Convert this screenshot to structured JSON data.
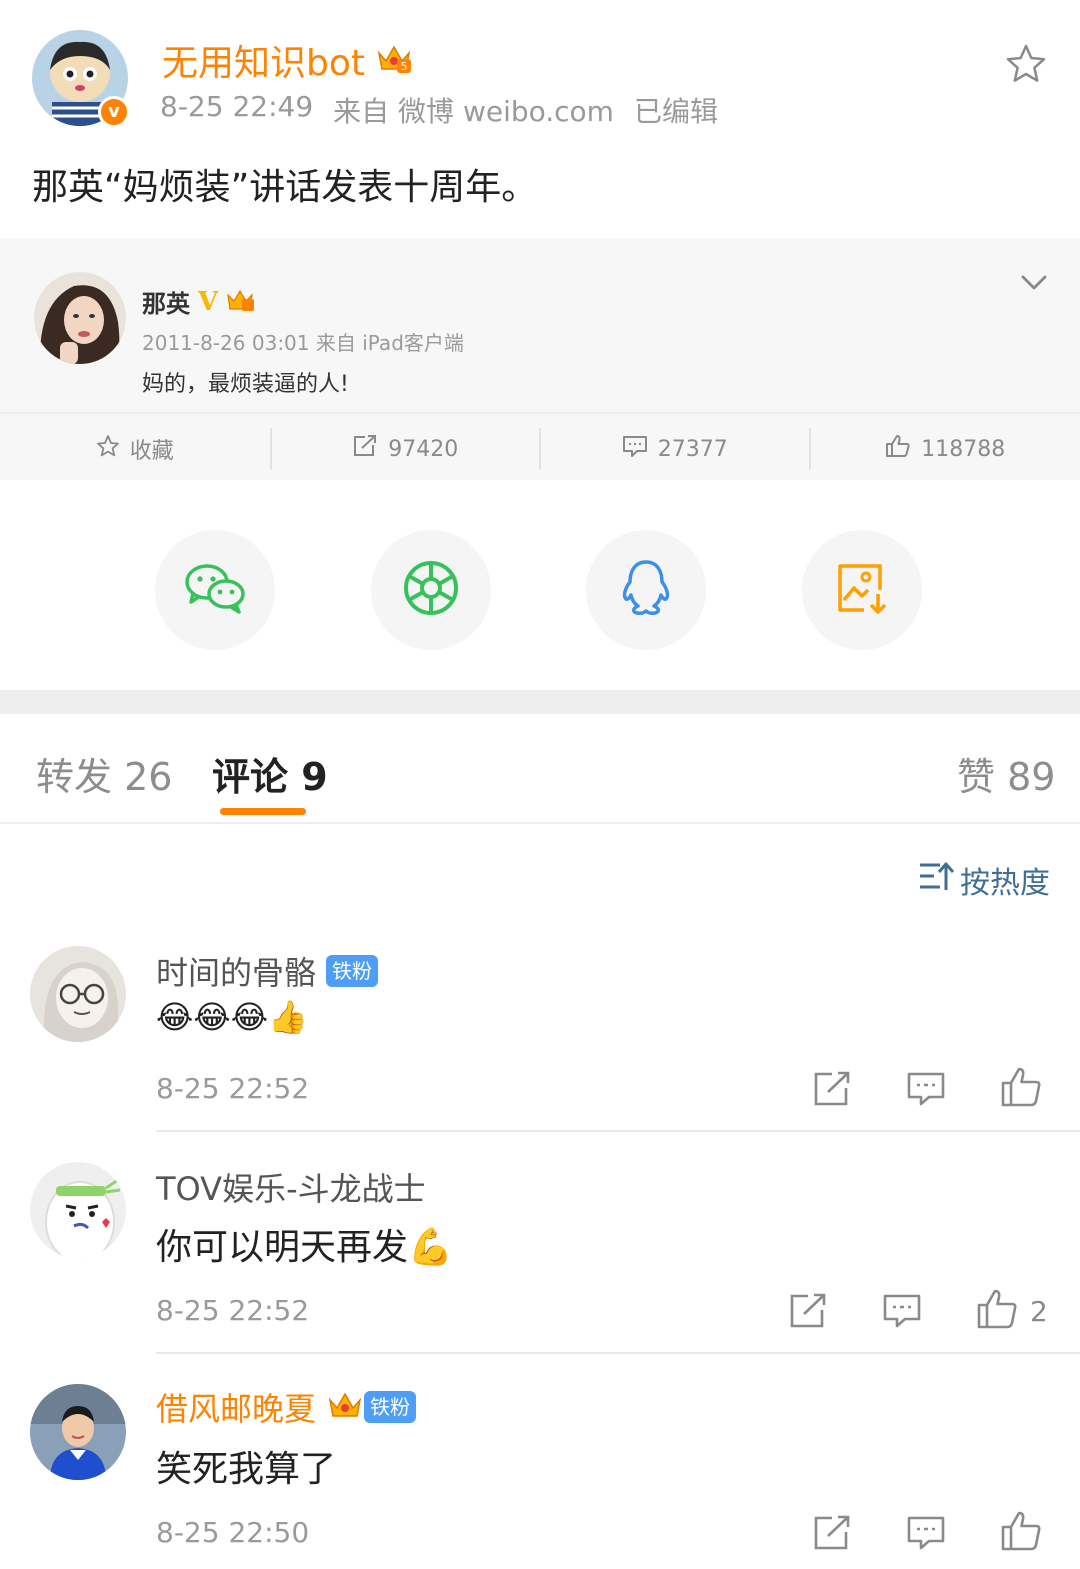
{
  "post": {
    "author": "无用知识bot",
    "time": "8-25 22:49",
    "source": "来自 微博 weibo.com",
    "edited": "已编辑",
    "text": "那英“妈烦装”讲话发表十周年。"
  },
  "quoted": {
    "author": "那英",
    "meta": "2011-8-26 03:01 来自 iPad客户端",
    "text": "妈的，最烦装逼的人!",
    "actions": {
      "favorite": "收藏",
      "reposts": "97420",
      "comments": "27377",
      "likes": "118788"
    }
  },
  "share": {
    "items": [
      "wechat-icon",
      "moments-icon",
      "qq-icon",
      "save-image-icon"
    ],
    "colors": {
      "wechat": "#37c15b",
      "moments": "#37c15b",
      "qq": "#3d8fe8",
      "save": "#ff9f00"
    }
  },
  "tabs": {
    "reposts": "转发 26",
    "comments": "评论 9",
    "likes": "赞 89"
  },
  "sort": {
    "label": "按热度"
  },
  "comments": [
    {
      "name": "时间的骨骼",
      "badge": "铁粉",
      "text": "😂😂😂👍",
      "time": "8-25 22:52",
      "likes": ""
    },
    {
      "name": "TOV娱乐-斗龙战士",
      "badge": "",
      "text": "你可以明天再发💪",
      "time": "8-25 22:52",
      "likes": "2"
    },
    {
      "name": "借风邮晚夏",
      "badge": "铁粉",
      "text": "笑死我算了",
      "time": "8-25 22:50",
      "likes": ""
    }
  ],
  "accent": "#ff8200"
}
